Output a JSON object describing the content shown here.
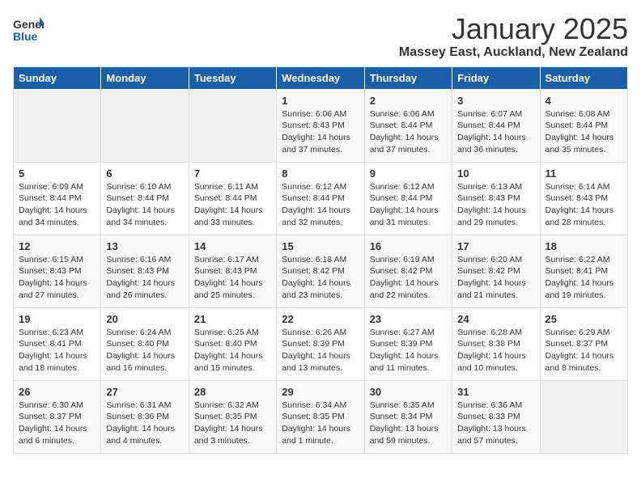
{
  "logo": {
    "text_general": "General",
    "text_blue": "Blue"
  },
  "title": "January 2025",
  "subtitle": "Massey East, Auckland, New Zealand",
  "days_of_week": [
    "Sunday",
    "Monday",
    "Tuesday",
    "Wednesday",
    "Thursday",
    "Friday",
    "Saturday"
  ],
  "weeks": [
    [
      {
        "day": "",
        "info": ""
      },
      {
        "day": "",
        "info": ""
      },
      {
        "day": "",
        "info": ""
      },
      {
        "day": "1",
        "info": "Sunrise: 6:06 AM\nSunset: 8:43 PM\nDaylight: 14 hours\nand 37 minutes."
      },
      {
        "day": "2",
        "info": "Sunrise: 6:06 AM\nSunset: 8:44 PM\nDaylight: 14 hours\nand 37 minutes."
      },
      {
        "day": "3",
        "info": "Sunrise: 6:07 AM\nSunset: 8:44 PM\nDaylight: 14 hours\nand 36 minutes."
      },
      {
        "day": "4",
        "info": "Sunrise: 6:08 AM\nSunset: 8:44 PM\nDaylight: 14 hours\nand 35 minutes."
      }
    ],
    [
      {
        "day": "5",
        "info": "Sunrise: 6:09 AM\nSunset: 8:44 PM\nDaylight: 14 hours\nand 34 minutes."
      },
      {
        "day": "6",
        "info": "Sunrise: 6:10 AM\nSunset: 8:44 PM\nDaylight: 14 hours\nand 34 minutes."
      },
      {
        "day": "7",
        "info": "Sunrise: 6:11 AM\nSunset: 8:44 PM\nDaylight: 14 hours\nand 33 minutes."
      },
      {
        "day": "8",
        "info": "Sunrise: 6:12 AM\nSunset: 8:44 PM\nDaylight: 14 hours\nand 32 minutes."
      },
      {
        "day": "9",
        "info": "Sunrise: 6:12 AM\nSunset: 8:44 PM\nDaylight: 14 hours\nand 31 minutes."
      },
      {
        "day": "10",
        "info": "Sunrise: 6:13 AM\nSunset: 8:43 PM\nDaylight: 14 hours\nand 29 minutes."
      },
      {
        "day": "11",
        "info": "Sunrise: 6:14 AM\nSunset: 8:43 PM\nDaylight: 14 hours\nand 28 minutes."
      }
    ],
    [
      {
        "day": "12",
        "info": "Sunrise: 6:15 AM\nSunset: 8:43 PM\nDaylight: 14 hours\nand 27 minutes."
      },
      {
        "day": "13",
        "info": "Sunrise: 6:16 AM\nSunset: 8:43 PM\nDaylight: 14 hours\nand 26 minutes."
      },
      {
        "day": "14",
        "info": "Sunrise: 6:17 AM\nSunset: 8:43 PM\nDaylight: 14 hours\nand 25 minutes."
      },
      {
        "day": "15",
        "info": "Sunrise: 6:18 AM\nSunset: 8:42 PM\nDaylight: 14 hours\nand 23 minutes."
      },
      {
        "day": "16",
        "info": "Sunrise: 6:19 AM\nSunset: 8:42 PM\nDaylight: 14 hours\nand 22 minutes."
      },
      {
        "day": "17",
        "info": "Sunrise: 6:20 AM\nSunset: 8:42 PM\nDaylight: 14 hours\nand 21 minutes."
      },
      {
        "day": "18",
        "info": "Sunrise: 6:22 AM\nSunset: 8:41 PM\nDaylight: 14 hours\nand 19 minutes."
      }
    ],
    [
      {
        "day": "19",
        "info": "Sunrise: 6:23 AM\nSunset: 8:41 PM\nDaylight: 14 hours\nand 18 minutes."
      },
      {
        "day": "20",
        "info": "Sunrise: 6:24 AM\nSunset: 8:40 PM\nDaylight: 14 hours\nand 16 minutes."
      },
      {
        "day": "21",
        "info": "Sunrise: 6:25 AM\nSunset: 8:40 PM\nDaylight: 14 hours\nand 15 minutes."
      },
      {
        "day": "22",
        "info": "Sunrise: 6:26 AM\nSunset: 8:39 PM\nDaylight: 14 hours\nand 13 minutes."
      },
      {
        "day": "23",
        "info": "Sunrise: 6:27 AM\nSunset: 8:39 PM\nDaylight: 14 hours\nand 11 minutes."
      },
      {
        "day": "24",
        "info": "Sunrise: 6:28 AM\nSunset: 8:38 PM\nDaylight: 14 hours\nand 10 minutes."
      },
      {
        "day": "25",
        "info": "Sunrise: 6:29 AM\nSunset: 8:37 PM\nDaylight: 14 hours\nand 8 minutes."
      }
    ],
    [
      {
        "day": "26",
        "info": "Sunrise: 6:30 AM\nSunset: 8:37 PM\nDaylight: 14 hours\nand 6 minutes."
      },
      {
        "day": "27",
        "info": "Sunrise: 6:31 AM\nSunset: 8:36 PM\nDaylight: 14 hours\nand 4 minutes."
      },
      {
        "day": "28",
        "info": "Sunrise: 6:32 AM\nSunset: 8:35 PM\nDaylight: 14 hours\nand 3 minutes."
      },
      {
        "day": "29",
        "info": "Sunrise: 6:34 AM\nSunset: 8:35 PM\nDaylight: 14 hours\nand 1 minute."
      },
      {
        "day": "30",
        "info": "Sunrise: 6:35 AM\nSunset: 8:34 PM\nDaylight: 13 hours\nand 59 minutes."
      },
      {
        "day": "31",
        "info": "Sunrise: 6:36 AM\nSunset: 8:33 PM\nDaylight: 13 hours\nand 57 minutes."
      },
      {
        "day": "",
        "info": ""
      }
    ]
  ]
}
